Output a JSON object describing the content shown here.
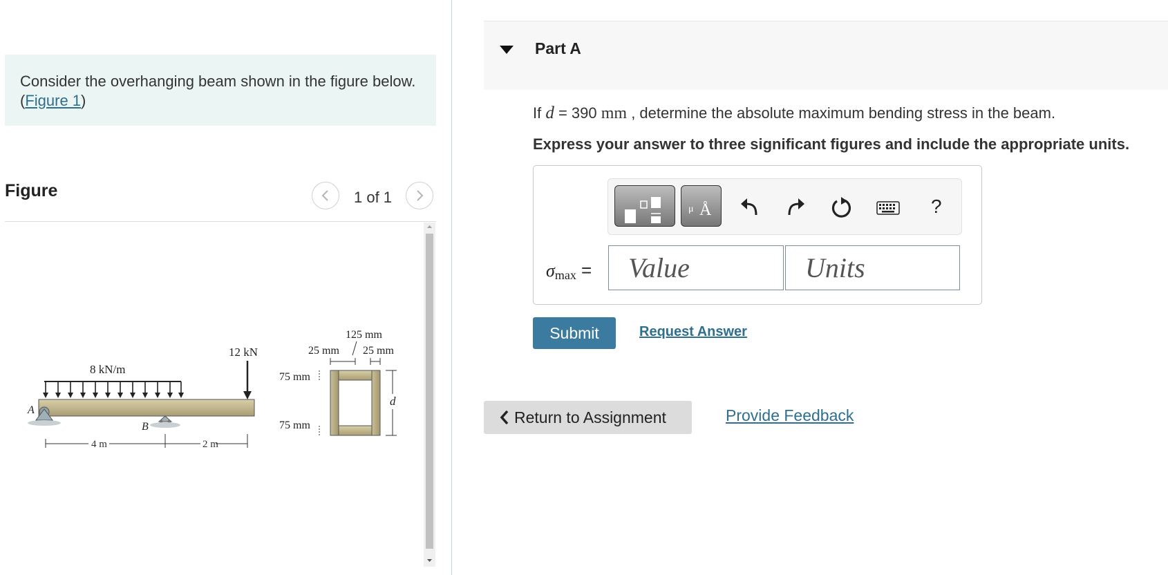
{
  "intro": {
    "text": "Consider the overhanging beam shown in the figure below. (",
    "figure_link": "Figure 1",
    "close": ")"
  },
  "figure_panel": {
    "title": "Figure",
    "pager": "1 of 1",
    "prev_icon": "chevron-left-icon",
    "next_icon": "chevron-right-icon"
  },
  "figure": {
    "distributed_load": "8 kN/m",
    "point_load": "12 kN",
    "support_a": "A",
    "support_b": "B",
    "span_1": "4 m",
    "span_2": "2 m",
    "width_total": "125 mm",
    "flange_left": "25 mm",
    "flange_right": "25 mm",
    "height_top": "75 mm",
    "height_bottom": "75 mm",
    "depth": "d"
  },
  "part": {
    "title": "Part A",
    "toggle_icon": "caret-down-icon"
  },
  "question": {
    "prefix": "If ",
    "variable": "d",
    "equals": " = 390 ",
    "unit": "mm",
    "suffix": " , determine the absolute maximum bending stress in the beam."
  },
  "instruction": "Express your answer to three significant figures and include the appropriate units.",
  "answer": {
    "symbol": "σ",
    "subscript": "max",
    "equals": " =",
    "value_placeholder": "Value",
    "units_placeholder": "Units",
    "symbols_glyph": "Å",
    "symbols_small": "μ",
    "help": "?"
  },
  "toolbar_icons": [
    "templates-icon",
    "symbols-icon",
    "undo-icon",
    "redo-icon",
    "reset-icon",
    "keyboard-icon",
    "help-icon"
  ],
  "actions": {
    "submit": "Submit",
    "request_answer": "Request Answer",
    "return": "Return to Assignment",
    "feedback": "Provide Feedback"
  },
  "colors": {
    "intro_bg": "#ebf5f4",
    "link": "#2e6f8f",
    "submit_bg": "#3b7ba0"
  }
}
